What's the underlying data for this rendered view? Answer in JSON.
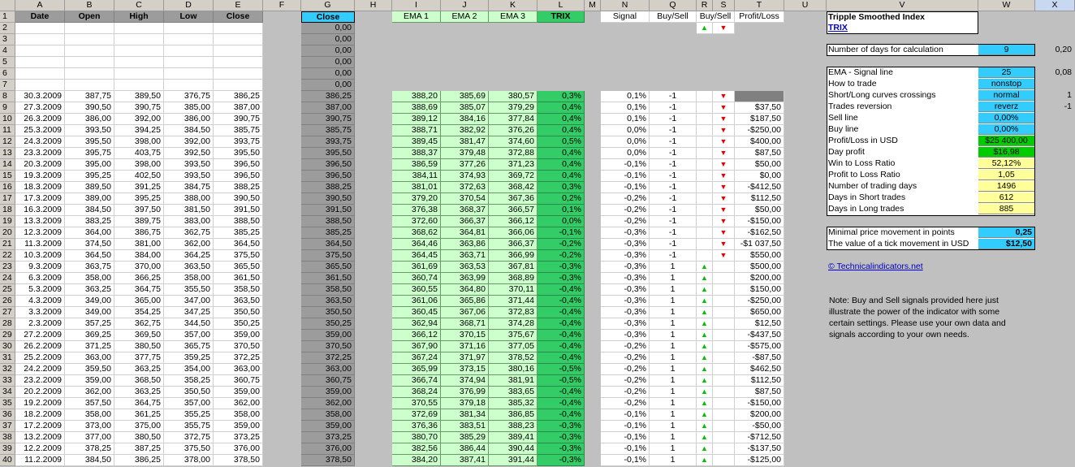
{
  "columns": [
    "A",
    "B",
    "C",
    "D",
    "E",
    "F",
    "G",
    "H",
    "I",
    "J",
    "K",
    "L",
    "M",
    "N",
    "Q",
    "R",
    "S",
    "T",
    "U",
    "V",
    "W",
    "X"
  ],
  "headers": {
    "date": "Date",
    "open": "Open",
    "high": "High",
    "low": "Low",
    "close": "Close",
    "close2": "Close",
    "ema1": "EMA 1",
    "ema2": "EMA 2",
    "ema3": "EMA 3",
    "trix": "TRIX",
    "signal": "Signal",
    "buysell": "Buy/Sell",
    "buysell2": "Buy/Sell",
    "pl": "Profit/Loss"
  },
  "zero_rows": [
    "0,00",
    "0,00",
    "0,00",
    "0,00",
    "0,00",
    "0,00"
  ],
  "rows": [
    [
      "30.3.2009",
      "387,75",
      "389,50",
      "376,75",
      "386,25",
      "386,25",
      "388,20",
      "385,69",
      "380,57",
      "0,3%",
      "0,1%",
      "-1",
      "d",
      ""
    ],
    [
      "27.3.2009",
      "390,50",
      "390,75",
      "385,00",
      "387,00",
      "387,00",
      "388,69",
      "385,07",
      "379,29",
      "0,4%",
      "0,1%",
      "-1",
      "d",
      "$37,50"
    ],
    [
      "26.3.2009",
      "386,00",
      "392,00",
      "386,00",
      "390,75",
      "390,75",
      "389,12",
      "384,16",
      "377,84",
      "0,4%",
      "0,1%",
      "-1",
      "d",
      "$187,50"
    ],
    [
      "25.3.2009",
      "393,50",
      "394,25",
      "384,50",
      "385,75",
      "385,75",
      "388,71",
      "382,92",
      "376,26",
      "0,4%",
      "0,0%",
      "-1",
      "d",
      "-$250,00"
    ],
    [
      "24.3.2009",
      "395,50",
      "398,00",
      "392,00",
      "393,75",
      "393,75",
      "389,45",
      "381,47",
      "374,60",
      "0,5%",
      "0,0%",
      "-1",
      "d",
      "$400,00"
    ],
    [
      "23.3.2009",
      "395,75",
      "403,75",
      "392,50",
      "395,50",
      "395,50",
      "388,37",
      "379,48",
      "372,88",
      "0,4%",
      "0,0%",
      "-1",
      "d",
      "$87,50"
    ],
    [
      "20.3.2009",
      "395,00",
      "398,00",
      "393,50",
      "396,50",
      "396,50",
      "386,59",
      "377,26",
      "371,23",
      "0,4%",
      "-0,1%",
      "-1",
      "d",
      "$50,00"
    ],
    [
      "19.3.2009",
      "395,25",
      "402,50",
      "393,50",
      "396,50",
      "396,50",
      "384,11",
      "374,93",
      "369,72",
      "0,4%",
      "-0,1%",
      "-1",
      "d",
      "$0,00"
    ],
    [
      "18.3.2009",
      "389,50",
      "391,25",
      "384,75",
      "388,25",
      "388,25",
      "381,01",
      "372,63",
      "368,42",
      "0,3%",
      "-0,1%",
      "-1",
      "d",
      "-$412,50"
    ],
    [
      "17.3.2009",
      "389,00",
      "395,25",
      "388,00",
      "390,50",
      "390,50",
      "379,20",
      "370,54",
      "367,36",
      "0,2%",
      "-0,2%",
      "-1",
      "d",
      "$112,50"
    ],
    [
      "16.3.2009",
      "384,50",
      "397,50",
      "381,50",
      "391,50",
      "391,50",
      "376,38",
      "368,37",
      "366,57",
      "0,1%",
      "-0,2%",
      "-1",
      "d",
      "$50,00"
    ],
    [
      "13.3.2009",
      "383,25",
      "389,75",
      "383,00",
      "388,50",
      "388,50",
      "372,60",
      "366,37",
      "366,12",
      "0,0%",
      "-0,2%",
      "-1",
      "d",
      "-$150,00"
    ],
    [
      "12.3.2009",
      "364,00",
      "386,75",
      "362,75",
      "385,25",
      "385,25",
      "368,62",
      "364,81",
      "366,06",
      "-0,1%",
      "-0,3%",
      "-1",
      "d",
      "-$162,50"
    ],
    [
      "11.3.2009",
      "374,50",
      "381,00",
      "362,00",
      "364,50",
      "364,50",
      "364,46",
      "363,86",
      "366,37",
      "-0,2%",
      "-0,3%",
      "-1",
      "d",
      "-$1 037,50"
    ],
    [
      "10.3.2009",
      "364,50",
      "384,00",
      "364,25",
      "375,50",
      "375,50",
      "364,45",
      "363,71",
      "366,99",
      "-0,2%",
      "-0,3%",
      "-1",
      "d",
      "$550,00"
    ],
    [
      "9.3.2009",
      "363,75",
      "370,00",
      "363,50",
      "365,50",
      "365,50",
      "361,69",
      "363,53",
      "367,81",
      "-0,3%",
      "-0,3%",
      "1",
      "u",
      "$500,00"
    ],
    [
      "6.3.2009",
      "358,00",
      "366,25",
      "358,00",
      "361,50",
      "361,50",
      "360,74",
      "363,99",
      "368,89",
      "-0,3%",
      "-0,3%",
      "1",
      "u",
      "$200,00"
    ],
    [
      "5.3.2009",
      "363,25",
      "364,75",
      "355,50",
      "358,50",
      "358,50",
      "360,55",
      "364,80",
      "370,11",
      "-0,4%",
      "-0,3%",
      "1",
      "u",
      "$150,00"
    ],
    [
      "4.3.2009",
      "349,00",
      "365,00",
      "347,00",
      "363,50",
      "363,50",
      "361,06",
      "365,86",
      "371,44",
      "-0,4%",
      "-0,3%",
      "1",
      "u",
      "-$250,00"
    ],
    [
      "3.3.2009",
      "349,00",
      "354,25",
      "347,25",
      "350,50",
      "350,50",
      "360,45",
      "367,06",
      "372,83",
      "-0,4%",
      "-0,3%",
      "1",
      "u",
      "$650,00"
    ],
    [
      "2.3.2009",
      "357,25",
      "362,75",
      "344,50",
      "350,25",
      "350,25",
      "362,94",
      "368,71",
      "374,28",
      "-0,4%",
      "-0,3%",
      "1",
      "u",
      "$12,50"
    ],
    [
      "27.2.2009",
      "369,25",
      "369,50",
      "357,00",
      "359,00",
      "359,00",
      "366,12",
      "370,15",
      "375,67",
      "-0,4%",
      "-0,3%",
      "1",
      "u",
      "-$437,50"
    ],
    [
      "26.2.2009",
      "371,25",
      "380,50",
      "365,75",
      "370,50",
      "370,50",
      "367,90",
      "371,16",
      "377,05",
      "-0,4%",
      "-0,2%",
      "1",
      "u",
      "-$575,00"
    ],
    [
      "25.2.2009",
      "363,00",
      "377,75",
      "359,25",
      "372,25",
      "372,25",
      "367,24",
      "371,97",
      "378,52",
      "-0,4%",
      "-0,2%",
      "1",
      "u",
      "-$87,50"
    ],
    [
      "24.2.2009",
      "359,50",
      "363,25",
      "354,00",
      "363,00",
      "363,00",
      "365,99",
      "373,15",
      "380,16",
      "-0,5%",
      "-0,2%",
      "1",
      "u",
      "$462,50"
    ],
    [
      "23.2.2009",
      "359,00",
      "368,50",
      "358,25",
      "360,75",
      "360,75",
      "366,74",
      "374,94",
      "381,91",
      "-0,5%",
      "-0,2%",
      "1",
      "u",
      "$112,50"
    ],
    [
      "20.2.2009",
      "362,00",
      "363,25",
      "350,50",
      "359,00",
      "359,00",
      "368,24",
      "376,99",
      "383,65",
      "-0,4%",
      "-0,2%",
      "1",
      "u",
      "$87,50"
    ],
    [
      "19.2.2009",
      "357,50",
      "364,75",
      "357,00",
      "362,00",
      "362,00",
      "370,55",
      "379,18",
      "385,32",
      "-0,4%",
      "-0,2%",
      "1",
      "u",
      "-$150,00"
    ],
    [
      "18.2.2009",
      "358,00",
      "361,25",
      "355,25",
      "358,00",
      "358,00",
      "372,69",
      "381,34",
      "386,85",
      "-0,4%",
      "-0,1%",
      "1",
      "u",
      "$200,00"
    ],
    [
      "17.2.2009",
      "373,00",
      "375,00",
      "355,75",
      "359,00",
      "359,00",
      "376,36",
      "383,51",
      "388,23",
      "-0,3%",
      "-0,1%",
      "1",
      "u",
      "-$50,00"
    ],
    [
      "13.2.2009",
      "377,00",
      "380,50",
      "372,75",
      "373,25",
      "373,25",
      "380,70",
      "385,29",
      "389,41",
      "-0,3%",
      "-0,1%",
      "1",
      "u",
      "-$712,50"
    ],
    [
      "12.2.2009",
      "378,25",
      "387,25",
      "375,50",
      "376,00",
      "376,00",
      "382,56",
      "386,44",
      "390,44",
      "-0,3%",
      "-0,1%",
      "1",
      "u",
      "-$137,50"
    ],
    [
      "11.2.2009",
      "384,50",
      "386,25",
      "378,00",
      "378,50",
      "378,50",
      "384,20",
      "387,41",
      "391,44",
      "-0,3%",
      "-0,1%",
      "1",
      "u",
      "-$125,00"
    ]
  ],
  "panel": {
    "title": "Tripple Smoothed Index",
    "subtitle": "TRIX",
    "days_label": "Number of days for calculation",
    "days_value": "9",
    "x4": "0,20",
    "ema_label": "EMA - Signal line",
    "ema_value": "25",
    "x9": "0,08",
    "x11": "1",
    "x12": "-1",
    "settings": [
      {
        "label": "How to trade",
        "value": "nonstop",
        "color": "cyan"
      },
      {
        "label": "Short/Long curves crossings",
        "value": "normal",
        "color": "cyan"
      },
      {
        "label": "Trades reversion",
        "value": "reverz",
        "color": "cyan"
      },
      {
        "label": "Sell line",
        "value": "0,00%",
        "color": "cyan"
      },
      {
        "label": "Buy line",
        "value": "0,00%",
        "color": "cyan"
      },
      {
        "label": "Profit/Loss in USD",
        "value": "$25 400,00",
        "color": "green"
      },
      {
        "label": "Day profit",
        "value": "$16,98",
        "color": "green"
      },
      {
        "label": "Win to Loss Ratio",
        "value": "52,12%",
        "color": "yellow"
      },
      {
        "label": "Profit to Loss Ratio",
        "value": "1,05",
        "color": "yellow"
      },
      {
        "label": "Number of trading days",
        "value": "1496",
        "color": "yellow"
      },
      {
        "label": "Days in Short trades",
        "value": "612",
        "color": "yellow"
      },
      {
        "label": "Days in Long trades",
        "value": "885",
        "color": "yellow"
      }
    ],
    "tick_label": "Minimal price movement in points",
    "tick_value": "0,25",
    "tickusd_label": "The value of a tick movement in USD",
    "tickusd_value": "$12,50",
    "link": "© Technicalindicators.net",
    "note": "Note: Buy and Sell signals provided here just illustrate the power of the indicator with some certain settings. Please use your own data and signals according to your own needs."
  },
  "colors": {
    "grid_bg": "#c0c0c0",
    "cyan": "#33ccff",
    "green": "#00cc00",
    "yellow": "#ffff99",
    "ema": "#ccffcc",
    "trix": "#33cc66"
  }
}
